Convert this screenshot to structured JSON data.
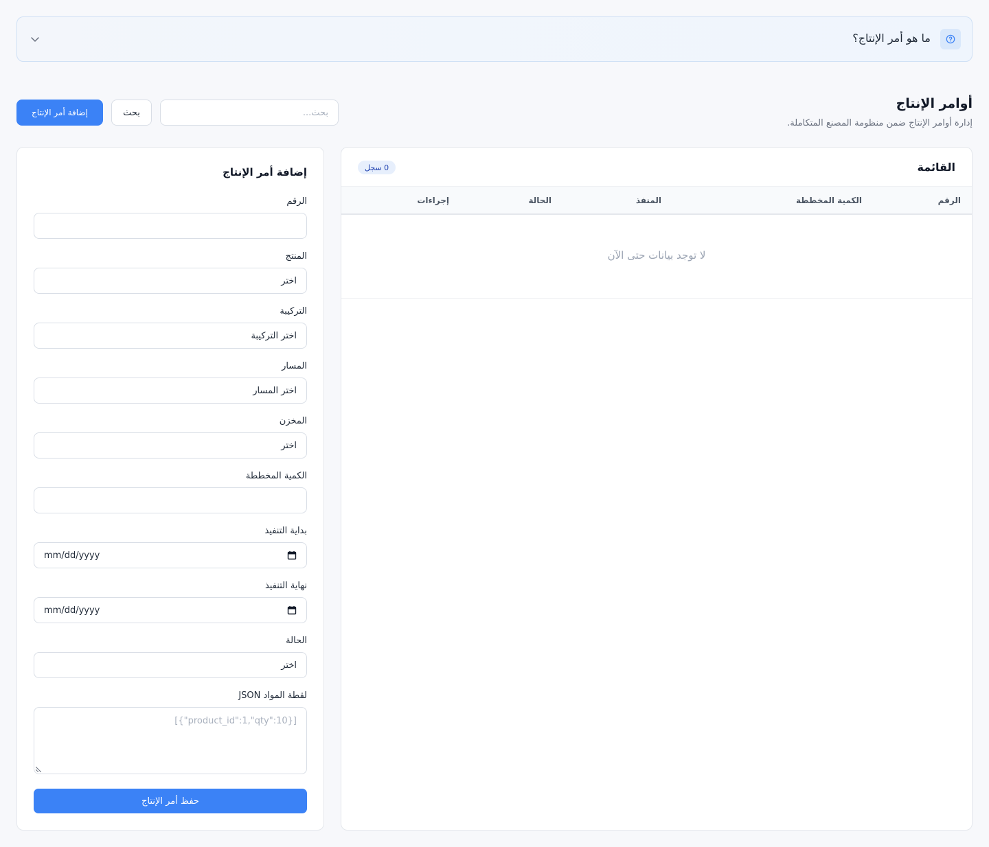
{
  "help": {
    "title": "ما هو أمر الإنتاج؟",
    "help_icon": "question-circle-icon",
    "toggle_icon": "chevron-down-icon"
  },
  "header": {
    "title": "أوامر الإنتاج",
    "subtitle": "إدارة أوامر الإنتاج ضمن منظومة المصنع المتكاملة."
  },
  "toolbar": {
    "search_placeholder": "بحث...",
    "search_value": "",
    "search_label": "بحث",
    "add_label": "إضافة أمر الإنتاج"
  },
  "list": {
    "title": "القائمة",
    "count_label": "0 سجل",
    "columns": [
      "الرقم",
      "الكمية المخططة",
      "المنفذ",
      "الحالة",
      "إجراءات"
    ],
    "empty_text": "لا توجد بيانات حتى الآن"
  },
  "form": {
    "title": "إضافة أمر الإنتاج",
    "fields": [
      {
        "label": "الرقم",
        "value": ""
      },
      {
        "label": "المنتج",
        "value": "اختر"
      },
      {
        "label": "التركيبة",
        "value": "اختر التركيبة"
      },
      {
        "label": "المسار",
        "value": "اختر المسار"
      },
      {
        "label": "المخزن",
        "value": "اختر"
      },
      {
        "label": "الكمية المخططة",
        "value": ""
      },
      {
        "label": "بداية التنفيذ",
        "value": "mm/dd/yyyy"
      },
      {
        "label": "نهاية التنفيذ",
        "value": "mm/dd/yyyy"
      },
      {
        "label": "الحالة",
        "value": "اختر"
      },
      {
        "label": "لقطة المواد JSON",
        "placeholder": "[{\"product_id\":1,\"qty\":10}]"
      }
    ],
    "save_label": "حفظ أمر الإنتاج"
  },
  "colors": {
    "accent": "#3b82f6",
    "background": "#f7f8fb",
    "banner_border": "#cfe0f5",
    "badge_bg": "#e7effc"
  }
}
